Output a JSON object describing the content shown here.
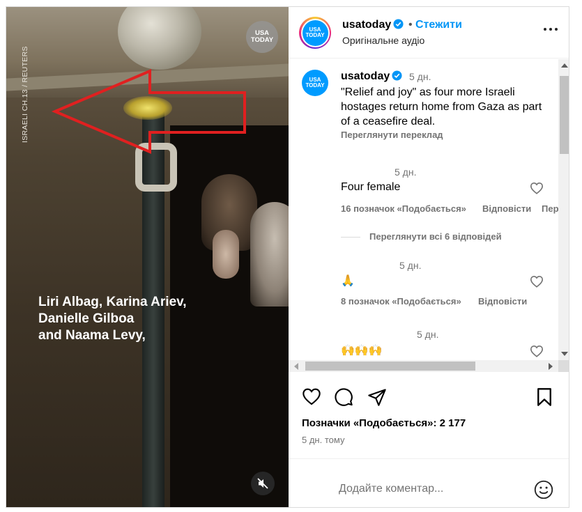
{
  "media": {
    "credit": "ISRAELI CH.13 / REUTERS",
    "logo": [
      "USA",
      "TODAY"
    ],
    "caption_lines": [
      "Liri Albag, Karina Ariev,",
      "Danielle Gilboa",
      "and Naama Levy,"
    ],
    "mute_icon": "speaker-muted-icon"
  },
  "header": {
    "username": "usatoday",
    "avatar": [
      "USA",
      "TODAY"
    ],
    "separator": "•",
    "follow_label": "Стежити",
    "audio": "Оригінальне аудіо",
    "more_icon": "more-horizontal-icon"
  },
  "caption": {
    "username": "usatoday",
    "avatar": [
      "USA",
      "TODAY"
    ],
    "time": "5 дн.",
    "text": "\"Relief and joy\" as four more Israeli hostages return home from Gaza as part of a ceasefire deal.",
    "translate": "Переглянути переклад"
  },
  "comments": [
    {
      "time": "5 дн.",
      "text": "Four female",
      "likes": "16 позначок «Подобається»",
      "reply": "Відповісти",
      "extra": "Пер",
      "view_replies": "Переглянути всі 6 відповідей"
    },
    {
      "time": "5 дн.",
      "text": "🙏",
      "likes": "8 позначок «Подобається»",
      "reply": "Відповісти"
    },
    {
      "time": "5 дн.",
      "text": "🙌🙌🙌"
    }
  ],
  "footer": {
    "likes_total": "Позначки «Подобається»: 2 177",
    "post_time": "5 дн. тому",
    "comment_placeholder": "Додайте коментар..."
  },
  "colors": {
    "accent": "#0095f6",
    "verified": "#0095f6",
    "muted_text": "#737373",
    "arrow": "#e02020",
    "brand_blue": "#009bff"
  }
}
